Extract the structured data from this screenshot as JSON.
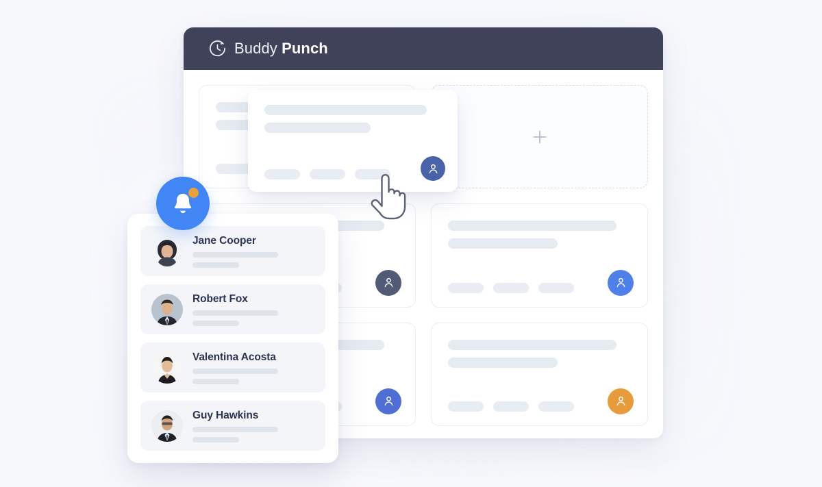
{
  "background": {
    "color": "#f7f8fc"
  },
  "app_window": {
    "titlebar": {
      "background": "#3f4259",
      "logo_icon": "clock-refresh-icon",
      "brand_light": "Buddy",
      "brand_bold": "Punch"
    },
    "cards": [
      {
        "id": "card-1",
        "type": "skeleton",
        "badge_color": "#5a6fb5",
        "badge_icon": "user-icon"
      },
      {
        "id": "card-2",
        "type": "add-placeholder",
        "icon": "plus-icon"
      },
      {
        "id": "card-3",
        "type": "skeleton",
        "badge_color": "#525b75",
        "badge_icon": "user-icon"
      },
      {
        "id": "card-4",
        "type": "skeleton",
        "badge_color": "#4f7fe8",
        "badge_icon": "user-icon"
      },
      {
        "id": "card-5",
        "type": "skeleton",
        "badge_color": "#4f6fd4",
        "badge_icon": "user-icon"
      },
      {
        "id": "card-6",
        "type": "skeleton",
        "badge_color": "#e89b3c",
        "badge_icon": "user-icon"
      }
    ]
  },
  "floating_card": {
    "badge_color": "#4a63a8",
    "badge_icon": "user-icon",
    "chips": 3,
    "skeleton_lines": 2
  },
  "cursor": {
    "icon": "pointing-hand-cursor"
  },
  "notification_button": {
    "icon": "bell-icon",
    "color": "#4285f4",
    "badge_dot_color": "#e9a13b",
    "has_unread": true
  },
  "notification_panel": {
    "rows": [
      {
        "name": "Jane Cooper",
        "avatar": "avatar-jane-cooper"
      },
      {
        "name": "Robert Fox",
        "avatar": "avatar-robert-fox"
      },
      {
        "name": "Valentina Acosta",
        "avatar": "avatar-valentina-acosta"
      },
      {
        "name": "Guy Hawkins",
        "avatar": "avatar-guy-hawkins"
      }
    ]
  }
}
